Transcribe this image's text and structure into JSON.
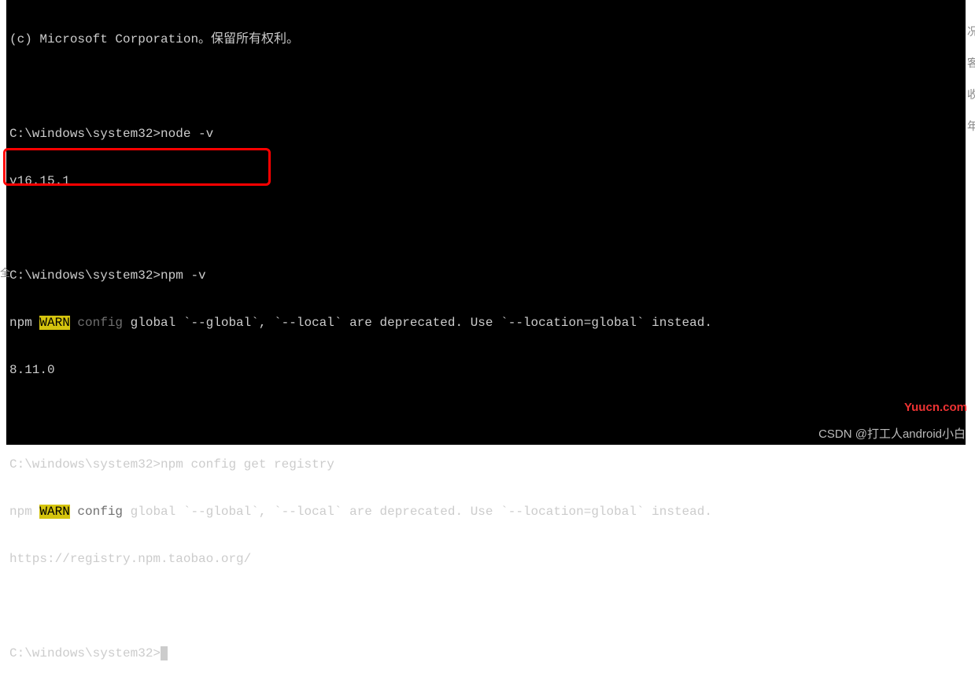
{
  "terminal": {
    "lines": {
      "copyright": "(c) Microsoft Corporation。保留所有权利。",
      "prompt1": "C:\\windows\\system32>",
      "cmd1": "node -v",
      "out1": "v16.15.1",
      "prompt2": "C:\\windows\\system32>",
      "cmd2": "npm -v",
      "warn2_prefix": "npm ",
      "warn2_warn": "WARN",
      "warn2_config": " config",
      "warn2_rest": " global `--global`, `--local` are deprecated. Use `--location=global` instead.",
      "out2": "8.11.0",
      "prompt3": "C:\\windows\\system32>",
      "cmd3": "npm config get registry",
      "warn3_prefix": "npm ",
      "warn3_warn": "WARN",
      "warn3_config": " config",
      "warn3_rest": " global `--global`, `--local` are deprecated. Use `--location=global` instead.",
      "out3": "https://registry.npm.taobao.org/",
      "prompt4": "C:\\windows\\system32>"
    }
  },
  "watermarks": {
    "right": "Yuucn.com",
    "bottom": "CSDN @打工人android小白"
  },
  "side": {
    "r1": "况",
    "r2": "客",
    "r3": "收",
    "r4": "年",
    "left": "全"
  }
}
